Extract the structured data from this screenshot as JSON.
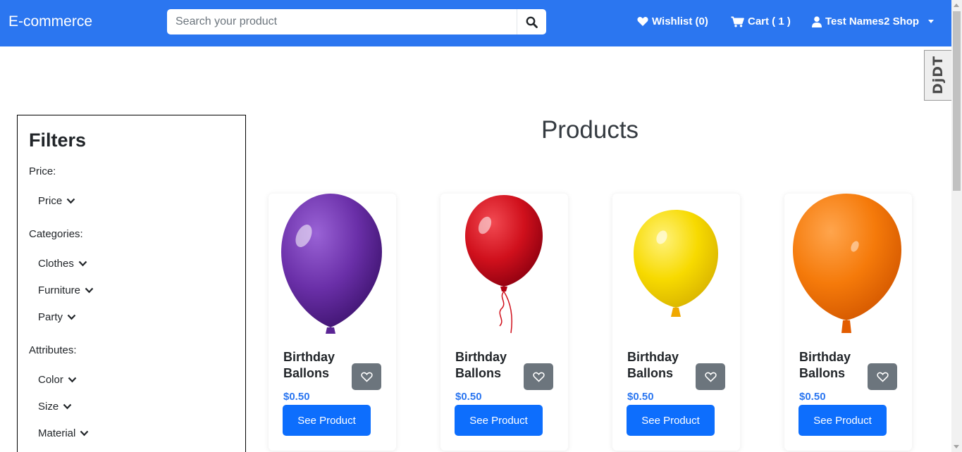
{
  "navbar": {
    "brand": "E-commerce",
    "search_placeholder": "Search your product",
    "wishlist_label": "Wishlist (0)",
    "cart_label": "Cart ( 1 )",
    "user_label": "Test Names2 Shop",
    "background_color": "#2b76f0"
  },
  "debug_toolbar": {
    "label": "DjDT"
  },
  "filters": {
    "title": "Filters",
    "price_label": "Price:",
    "price_items": [
      "Price"
    ],
    "categories_label": "Categories:",
    "category_items": [
      "Clothes",
      "Furniture",
      "Party"
    ],
    "attributes_label": "Attributes:",
    "attribute_items": [
      "Color",
      "Size",
      "Material"
    ]
  },
  "main": {
    "title": "Products",
    "products": [
      {
        "name": "Birthday Ballons",
        "price": "$0.50",
        "button": "See Product",
        "balloon_color": "#6a2fa8"
      },
      {
        "name": "Birthday Ballons",
        "price": "$0.50",
        "button": "See Product",
        "balloon_color": "#d0101c"
      },
      {
        "name": "Birthday Ballons",
        "price": "$0.50",
        "button": "See Product",
        "balloon_color": "#f7da00"
      },
      {
        "name": "Birthday Ballons",
        "price": "$0.50",
        "button": "See Product",
        "balloon_color": "#f57a0a"
      }
    ]
  },
  "icons": {
    "search": "search-icon",
    "wishlist": "heart-icon",
    "cart": "cart-icon",
    "user": "user-icon",
    "chevron": "chevron-down-icon"
  }
}
